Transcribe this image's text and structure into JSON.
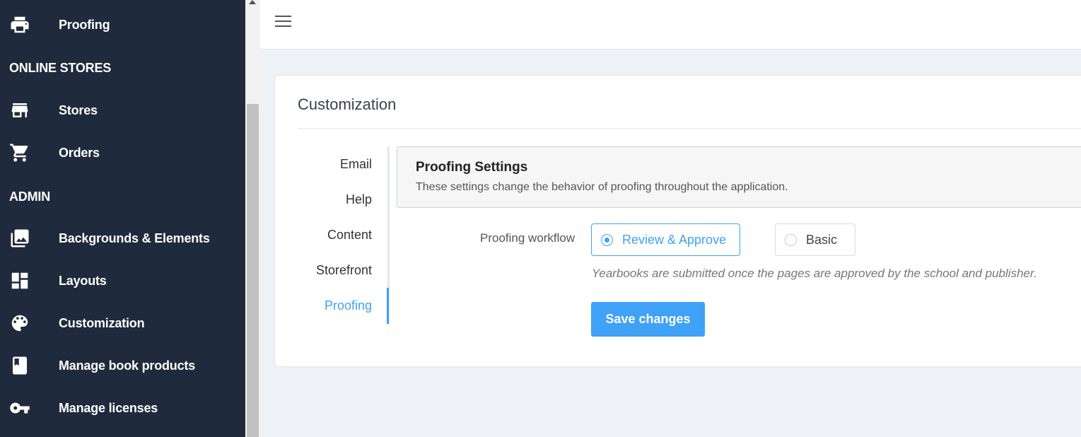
{
  "sidebar": {
    "items": [
      {
        "label": "Proofing",
        "icon": "printer-icon"
      },
      {
        "label": "Stores",
        "icon": "store-icon"
      },
      {
        "label": "Orders",
        "icon": "cart-icon"
      },
      {
        "label": "Backgrounds & Elements",
        "icon": "images-icon"
      },
      {
        "label": "Layouts",
        "icon": "dashboard-icon"
      },
      {
        "label": "Customization",
        "icon": "palette-icon"
      },
      {
        "label": "Manage book products",
        "icon": "book-icon"
      },
      {
        "label": "Manage licenses",
        "icon": "key-icon"
      }
    ],
    "sections": [
      "ONLINE STORES",
      "ADMIN"
    ]
  },
  "card": {
    "title": "Customization",
    "tabs": [
      "Email",
      "Help",
      "Content",
      "Storefront",
      "Proofing"
    ],
    "active_tab": "Proofing"
  },
  "panel": {
    "title": "Proofing Settings",
    "description": "These settings change the behavior of proofing throughout the application.",
    "workflow_label": "Proofing workflow",
    "options": [
      "Review & Approve",
      "Basic"
    ],
    "selected_option": "Review & Approve",
    "hint": "Yearbooks are submitted once the pages are approved by the school and publisher.",
    "save_label": "Save changes"
  },
  "colors": {
    "sidebar_bg": "#1f2a3c",
    "accent": "#3fa2f7",
    "page_bg": "#eef1f6"
  }
}
